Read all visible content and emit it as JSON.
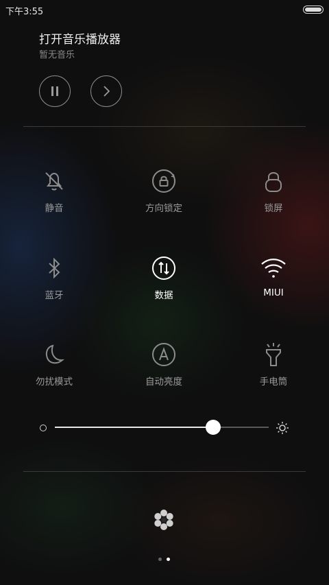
{
  "status": {
    "time": "下午3:55"
  },
  "music": {
    "title": "打开音乐播放器",
    "subtitle": "暂无音乐"
  },
  "toggles": [
    {
      "label": "静音",
      "icon": "bell-off-icon",
      "on": false
    },
    {
      "label": "方向锁定",
      "icon": "rotation-lock-icon",
      "on": false
    },
    {
      "label": "锁屏",
      "icon": "lock-icon",
      "on": false
    },
    {
      "label": "蓝牙",
      "icon": "bluetooth-icon",
      "on": false
    },
    {
      "label": "数据",
      "icon": "mobile-data-icon",
      "on": true
    },
    {
      "label": "MIUI",
      "icon": "wifi-icon",
      "on": true
    },
    {
      "label": "勿扰模式",
      "icon": "moon-icon",
      "on": false
    },
    {
      "label": "自动亮度",
      "icon": "auto-brightness-icon",
      "on": false
    },
    {
      "label": "手电筒",
      "icon": "flashlight-icon",
      "on": false
    }
  ],
  "brightness": {
    "level_percent": 74
  },
  "pager": {
    "page_count": 2,
    "active_page": 2
  },
  "colors": {
    "on": "#ffffff",
    "off": "#9a9a9a",
    "icon_off": "#8c8c8c"
  }
}
